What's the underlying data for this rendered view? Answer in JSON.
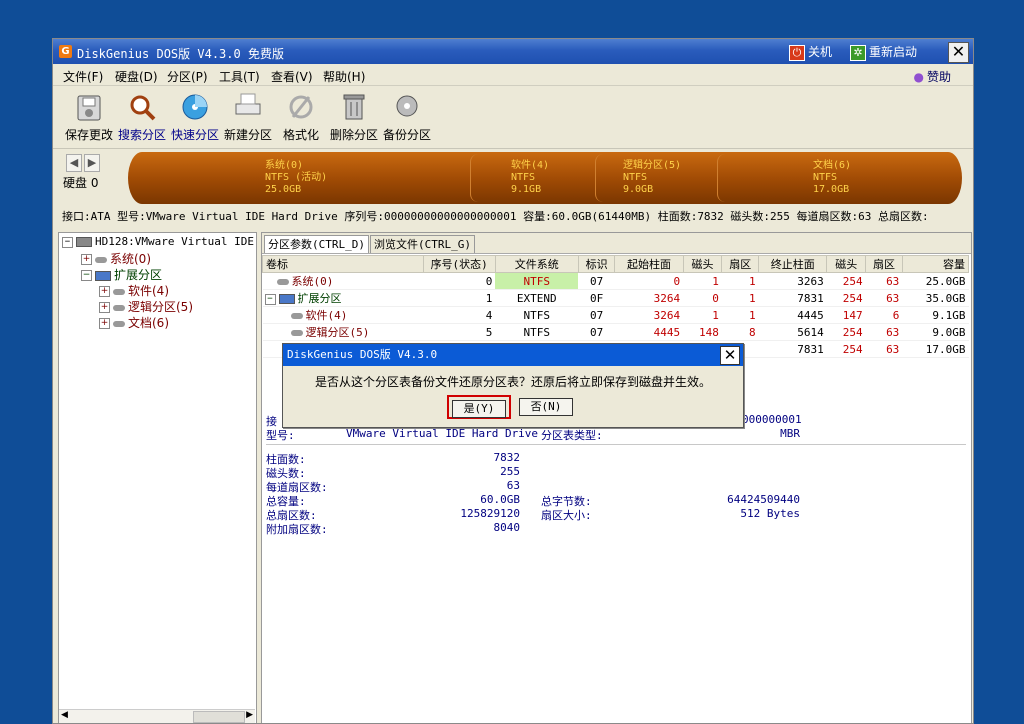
{
  "window": {
    "title": "DiskGenius DOS版 V4.3.0 免费版",
    "shutdown": "关机",
    "restart": "重新启动",
    "close": "✕"
  },
  "menu": [
    "文件(F)",
    "硬盘(D)",
    "分区(P)",
    "工具(T)",
    "查看(V)",
    "帮助(H)"
  ],
  "sponsor": "赞助",
  "toolbar": [
    "保存更改",
    "搜索分区",
    "快速分区",
    "新建分区",
    "格式化",
    "删除分区",
    "备份分区"
  ],
  "disk": {
    "label": "硬盘 0",
    "segments": [
      {
        "l1": "系统(0)",
        "l2": "NTFS (活动)",
        "l3": "25.0GB"
      },
      {
        "l1": "软件(4)",
        "l2": "NTFS",
        "l3": "9.1GB"
      },
      {
        "l1": "逻辑分区(5)",
        "l2": "NTFS",
        "l3": "9.0GB"
      },
      {
        "l1": "文档(6)",
        "l2": "NTFS",
        "l3": "17.0GB"
      }
    ],
    "info": "接口:ATA  型号:VMware Virtual IDE Hard Drive  序列号:00000000000000000001  容量:60.0GB(61440MB)  柱面数:7832  磁头数:255  每道扇区数:63  总扇区数:"
  },
  "tree": {
    "root": "HD128:VMware Virtual IDE Ha",
    "items": [
      "系统(0)",
      "扩展分区",
      "软件(4)",
      "逻辑分区(5)",
      "文档(6)"
    ]
  },
  "tabs": [
    "分区参数(CTRL_D)",
    "浏览文件(CTRL_G)"
  ],
  "columns": [
    "卷标",
    "序号(状态)",
    "文件系统",
    "标识",
    "起始柱面",
    "磁头",
    "扇区",
    "终止柱面",
    "磁头",
    "扇区",
    "容量"
  ],
  "rows": [
    [
      "系统(0)",
      "0",
      "NTFS",
      "07",
      "0",
      "1",
      "1",
      "3263",
      "254",
      "63",
      "25.0GB"
    ],
    [
      "扩展分区",
      "1",
      "EXTEND",
      "0F",
      "3264",
      "0",
      "1",
      "7831",
      "254",
      "63",
      "35.0GB"
    ],
    [
      "软件(4)",
      "4",
      "NTFS",
      "07",
      "3264",
      "1",
      "1",
      "4445",
      "147",
      "6",
      "9.1GB"
    ],
    [
      "逻辑分区(5)",
      "5",
      "NTFS",
      "07",
      "4445",
      "148",
      "8",
      "5614",
      "254",
      "63",
      "9.0GB"
    ],
    [
      "",
      "",
      "",
      "",
      "",
      "",
      "",
      "7831",
      "254",
      "63",
      "17.0GB"
    ]
  ],
  "details": {
    "iface_prefix": "接",
    "serial_tail": "000000001",
    "model_label": "型号:",
    "model_value": "VMware Virtual IDE Hard Drive",
    "pt_label": "分区表类型:",
    "pt_value": "MBR",
    "cyl_label": "柱面数:",
    "cyl_value": "7832",
    "heads_label": "磁头数:",
    "heads_value": "255",
    "spt_label": "每道扇区数:",
    "spt_value": "63",
    "cap_label": "总容量:",
    "cap_value": "60.0GB",
    "bytes_label": "总字节数:",
    "bytes_value": "64424509440",
    "sectors_label": "总扇区数:",
    "sectors_value": "125829120",
    "ssize_label": "扇区大小:",
    "ssize_value": "512 Bytes",
    "extra_label": "附加扇区数:",
    "extra_value": "8040"
  },
  "dialog": {
    "title": "DiskGenius DOS版 V4.3.0",
    "message": "是否从这个分区表备份文件还原分区表？还原后将立即保存到磁盘并生效。",
    "yes": "是(Y)",
    "no": "否(N)",
    "close": "✕"
  }
}
